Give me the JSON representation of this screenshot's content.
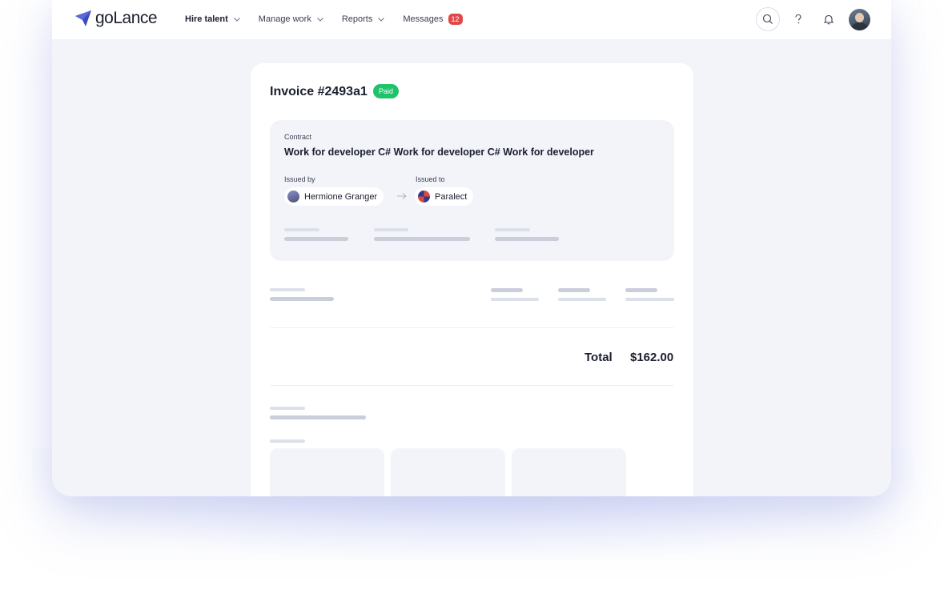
{
  "brand": {
    "name": "goLance",
    "color": "#3b4bbf"
  },
  "nav": {
    "items": [
      {
        "label": "Hire talent",
        "active": true
      },
      {
        "label": "Manage work",
        "active": false
      },
      {
        "label": "Reports",
        "active": false
      }
    ],
    "messages": {
      "label": "Messages",
      "count": "12"
    }
  },
  "header_icons": [
    "search-icon",
    "help-icon",
    "bell-icon",
    "user-avatar"
  ],
  "invoice": {
    "title": "Invoice #2493a1",
    "status": "Paid",
    "status_color": "#1fc36b",
    "contract_label": "Contract",
    "contract_title": "Work for developer C# Work for developer C# Work for developer",
    "issued_by_label": "Issued by",
    "issued_by_name": "Hermione Granger",
    "issued_to_label": "Issued to",
    "issued_to_name": "Paralect",
    "total_label": "Total",
    "total_value": "$162.00"
  }
}
